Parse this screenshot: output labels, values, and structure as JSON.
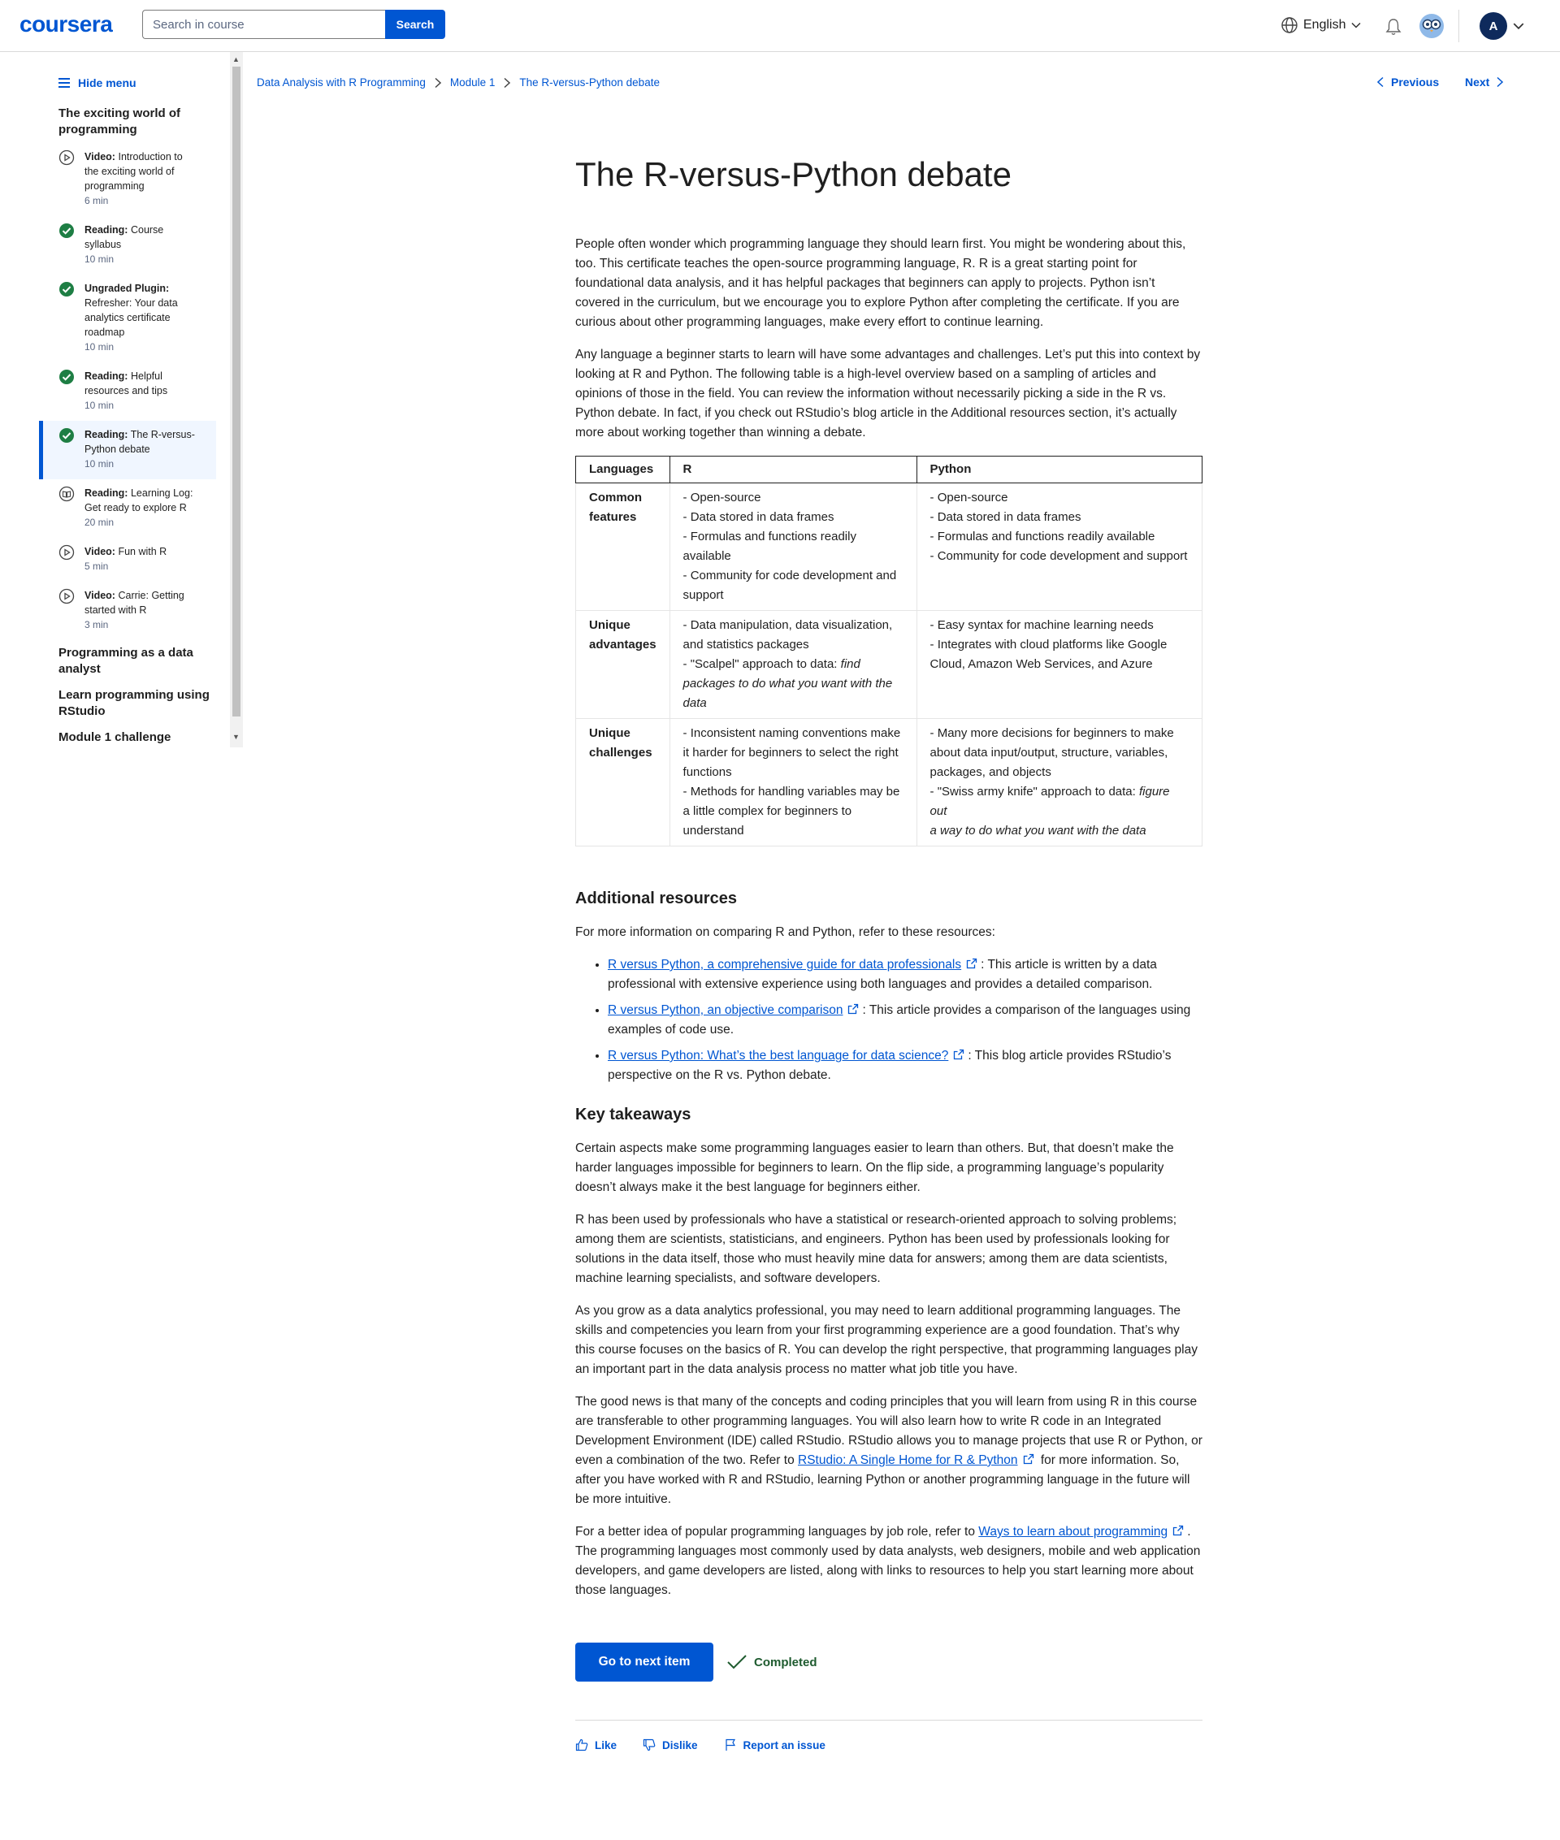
{
  "header": {
    "logo": "coursera",
    "search_placeholder": "Search in course",
    "search_button": "Search",
    "language": "English",
    "avatar_initial": "A"
  },
  "sidebar": {
    "hide_menu": "Hide menu",
    "module_title": "The exciting world of programming",
    "items": [
      {
        "kind": "Video:",
        "title": "Introduction to the exciting world of programming",
        "duration": "6 min",
        "status": "not-started",
        "icon": "play-circle-icon"
      },
      {
        "kind": "Reading:",
        "title": "Course syllabus",
        "duration": "10 min",
        "status": "completed",
        "icon": "check-circle-icon"
      },
      {
        "kind": "Ungraded Plugin:",
        "title": "Refresher: Your data analytics certificate roadmap",
        "duration": "10 min",
        "status": "completed",
        "icon": "check-circle-icon"
      },
      {
        "kind": "Reading:",
        "title": "Helpful resources and tips",
        "duration": "10 min",
        "status": "completed",
        "icon": "check-circle-icon"
      },
      {
        "kind": "Reading:",
        "title": "The R-versus-Python debate",
        "duration": "10 min",
        "status": "completed",
        "icon": "check-circle-icon",
        "active": true
      },
      {
        "kind": "Reading:",
        "title": "Learning Log: Get ready to explore R",
        "duration": "20 min",
        "status": "not-started",
        "icon": "reading-icon"
      },
      {
        "kind": "Video:",
        "title": "Fun with R",
        "duration": "5 min",
        "status": "not-started",
        "icon": "play-circle-icon"
      },
      {
        "kind": "Video:",
        "title": "Carrie: Getting started with R",
        "duration": "3 min",
        "status": "not-started",
        "icon": "play-circle-icon"
      }
    ],
    "other_sections": [
      "Programming as a data analyst",
      "Learn programming using RStudio",
      "Module 1 challenge"
    ]
  },
  "breadcrumb": [
    "Data Analysis with R Programming",
    "Module 1",
    "The R-versus-Python debate"
  ],
  "nav": {
    "previous": "Previous",
    "next": "Next"
  },
  "article": {
    "title": "The R-versus-Python debate",
    "intro_paragraphs": [
      "People often wonder which programming language they should learn first. You might be wondering about this, too. This certificate teaches the open-source programming language, R. R is a great starting point for foundational data analysis, and it has helpful packages that beginners can apply to projects. Python isn’t covered in the curriculum, but we encourage you to explore Python after completing the certificate. If you are curious about other programming languages, make every effort to continue learning.",
      "Any language a beginner starts to learn will have some advantages and challenges. Let’s put this into context by looking at R and Python. The following table is a high-level overview based on a sampling of articles and opinions of those in the field. You can review the information without necessarily picking a side in the R vs. Python debate. In fact, if you check out RStudio’s blog article in the Additional resources section, it’s actually more about working together than winning a debate."
    ],
    "table": {
      "headers": [
        "Languages",
        "R",
        "Python"
      ],
      "rows": [
        {
          "label": "Common features",
          "r": [
            "- Open-source",
            "- Data stored in data frames",
            "- Formulas and functions readily available",
            "- Community for code development and support"
          ],
          "python": [
            "- Open-source",
            "- Data stored in data frames",
            "- Formulas and functions readily available",
            "- Community for code development and support"
          ]
        },
        {
          "label": "Unique advantages",
          "r": [
            "- Data manipulation, data visualization, and statistics packages",
            "- \"Scalpel\" approach to data: ",
            "find packages to do what you want with the data"
          ],
          "python": [
            "- Easy syntax for machine learning needs",
            "- Integrates with cloud platforms like Google Cloud, Amazon Web Services, and Azure"
          ]
        },
        {
          "label": "Unique challenges",
          "r": [
            "- Inconsistent naming conventions make it harder for beginners to select the right functions",
            "- Methods for handling variables may be a little complex for beginners to understand"
          ],
          "python": [
            "- Many more decisions for beginners to make about data input/output, structure, variables, packages, and objects",
            "- \"Swiss army knife\" approach to data: ",
            "figure out",
            "a way to do what you want with the data"
          ]
        }
      ]
    },
    "resources_heading": "Additional resources",
    "resources_intro": "For more information on comparing R and Python, refer to these resources:",
    "resources": [
      {
        "link": "R versus Python, a comprehensive guide for data professionals",
        "desc": ": This article is written by a data professional with extensive experience using both languages and provides a detailed comparison."
      },
      {
        "link": "R versus Python, an objective comparison",
        "desc": ": This article provides a comparison of the languages using examples of code use."
      },
      {
        "link": "R versus Python: What’s the best language for data science?",
        "desc": ": This blog article provides RStudio’s perspective on the R vs. Python debate."
      }
    ],
    "takeaways_heading": "Key takeaways",
    "takeaways": [
      "Certain aspects make some programming languages easier to learn than others. But, that doesn’t make the harder languages impossible for beginners to learn. On the flip side, a programming language’s popularity doesn’t always make it the best language for beginners either.",
      "R has been used by professionals who have a statistical or research-oriented approach to solving problems; among them are scientists, statisticians, and engineers. Python has been used by professionals looking for solutions in the data itself, those who must heavily mine data for answers; among them are data scientists, machine learning specialists, and software developers.",
      "As you grow as a data analytics professional, you may need to learn additional programming languages. The skills and competencies you learn from your first programming experience are a good foundation. That’s why this course focuses on the basics of R. You can develop the right perspective, that programming languages play an important part in the data analysis process no matter what job title you have."
    ],
    "p_good_news_before": "The good news is that many of the concepts and coding principles that you will learn from using R in this course are transferable to other programming languages. You will also learn how to write R code in an Integrated Development Environment (IDE) called RStudio. RStudio allows you to manage projects that use R or Python, or even a combination of the two. Refer to ",
    "p_good_news_link": "RStudio: A Single Home for R & Python",
    "p_good_news_after": " for more information. So, after you have worked with R and RStudio, learning Python or another programming language in the future will be more intuitive.",
    "p_ways_before": "For a better idea of popular programming languages by job role, refer to ",
    "p_ways_link": "Ways to learn about programming",
    "p_ways_after": ". The programming languages most commonly used by data analysts, web designers, mobile and web application developers, and game developers are listed, along with links to resources to help you start learning more about those languages."
  },
  "actions": {
    "next_item": "Go to next item",
    "completed": "Completed"
  },
  "feedback": {
    "like": "Like",
    "dislike": "Dislike",
    "report": "Report an issue"
  }
}
